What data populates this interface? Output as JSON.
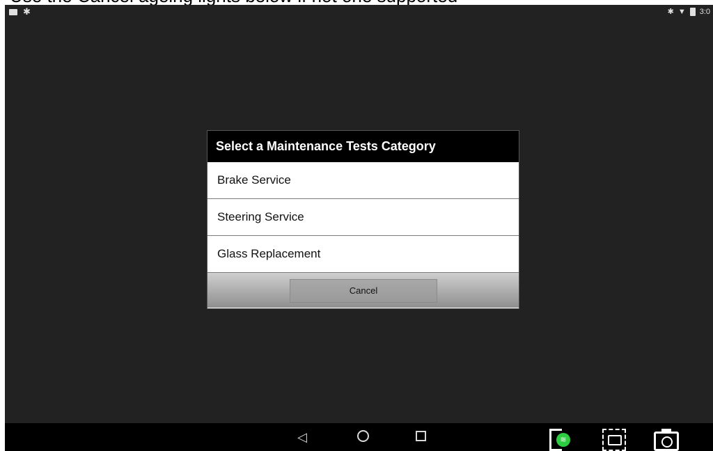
{
  "caption": "Use the Cancel ageing lights below if not one supported",
  "status_bar": {
    "time": "3:0",
    "icons": [
      "message-icon",
      "settings-icon",
      "bluetooth-icon",
      "wifi-icon",
      "battery-icon"
    ]
  },
  "dialog": {
    "title": "Select a Maintenance Tests Category",
    "items": [
      {
        "label": "Brake Service"
      },
      {
        "label": "Steering Service"
      },
      {
        "label": "Glass Replacement"
      }
    ],
    "cancel_label": "Cancel"
  },
  "nav_bar": {
    "back_glyph": "◁",
    "icons": [
      "back-icon",
      "home-icon",
      "recent-apps-icon",
      "phone-wifi-icon",
      "screenshot-select-icon",
      "camera-icon"
    ]
  }
}
